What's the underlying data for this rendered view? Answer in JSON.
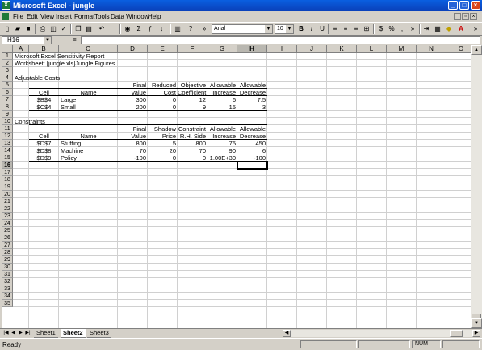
{
  "window": {
    "title": "Microsoft Excel - jungle"
  },
  "menu": [
    "File",
    "Edit",
    "View",
    "Insert",
    "Format",
    "Tools",
    "Data",
    "Window",
    "Help"
  ],
  "toolbar": {
    "font_name": "Arial",
    "font_size": "10"
  },
  "formula_bar": {
    "name_box": "H16",
    "fx": "=",
    "content": ""
  },
  "columns": [
    "A",
    "B",
    "C",
    "D",
    "E",
    "F",
    "G",
    "H",
    "I",
    "J",
    "K",
    "L",
    "M",
    "N",
    "O"
  ],
  "rows": [
    "1",
    "2",
    "3",
    "4",
    "5",
    "6",
    "7",
    "8",
    "9",
    "10",
    "11",
    "12",
    "13",
    "14",
    "15",
    "16",
    "17",
    "18",
    "19",
    "20",
    "21",
    "22",
    "23",
    "24",
    "25",
    "26",
    "27",
    "28",
    "29",
    "30",
    "31",
    "32",
    "33",
    "34",
    "35"
  ],
  "active_cell": {
    "column": "H",
    "row": "16"
  },
  "report": {
    "title": "Microsoft Excel Sensitivity Report",
    "worksheet": "Worksheet: [jungle.xls]Jungle Figures",
    "adjustable_heading": "Adjustable Costs",
    "adj_hdr_top": [
      "Final",
      "Reduced",
      "Objective",
      "Allowable",
      "Allowable"
    ],
    "adj_hdr_bottom": [
      "Cell",
      "Name",
      "Value",
      "Cost",
      "Coefficient",
      "Increase",
      "Decrease"
    ],
    "adjustable_rows": [
      [
        "$B$4",
        "Large",
        "300",
        "0",
        "12",
        "6",
        "7.5"
      ],
      [
        "$C$4",
        "Small",
        "200",
        "0",
        "9",
        "15",
        "3"
      ]
    ],
    "constraints_heading": "Constraints",
    "con_hdr_top": [
      "Final",
      "Shadow",
      "Constraint",
      "Allowable",
      "Allowable"
    ],
    "con_hdr_bottom": [
      "Cell",
      "Name",
      "Value",
      "Price",
      "R.H. Side",
      "Increase",
      "Decrease"
    ],
    "constraint_rows": [
      [
        "$D$7",
        "Stuffing",
        "800",
        "5",
        "800",
        "75",
        "450"
      ],
      [
        "$D$8",
        "Machine",
        "70",
        "20",
        "70",
        "90",
        "6"
      ],
      [
        "$D$9",
        "Policy",
        "-100",
        "0",
        "0",
        "1.00E+30",
        "-100"
      ]
    ]
  },
  "sheets": [
    {
      "name": "Sheet1",
      "active": false
    },
    {
      "name": "Sheet2",
      "active": true
    },
    {
      "name": "Sheet3",
      "active": false
    }
  ],
  "status": {
    "left": "Ready",
    "num": "NUM"
  }
}
